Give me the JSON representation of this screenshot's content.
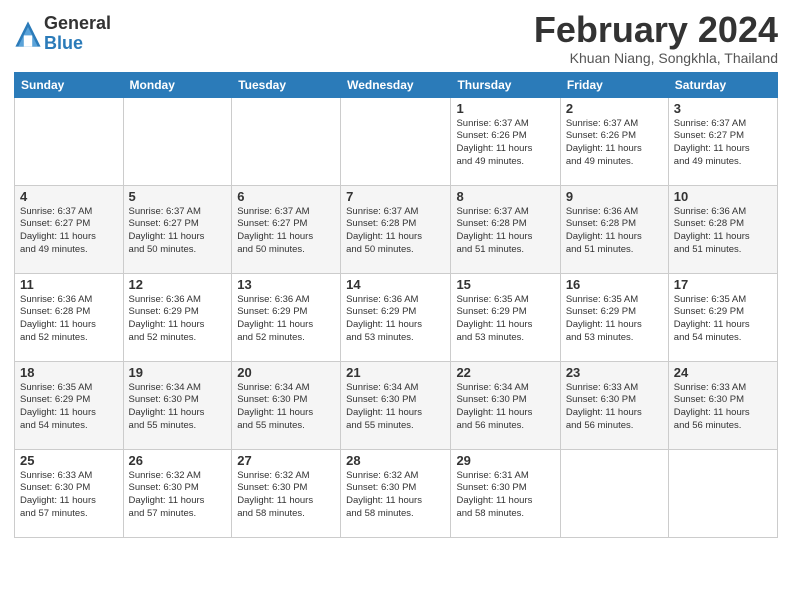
{
  "logo": {
    "general": "General",
    "blue": "Blue"
  },
  "title": {
    "month_year": "February 2024",
    "location": "Khuan Niang, Songkhla, Thailand"
  },
  "days_of_week": [
    "Sunday",
    "Monday",
    "Tuesday",
    "Wednesday",
    "Thursday",
    "Friday",
    "Saturday"
  ],
  "weeks": [
    [
      {
        "day": "",
        "info": ""
      },
      {
        "day": "",
        "info": ""
      },
      {
        "day": "",
        "info": ""
      },
      {
        "day": "",
        "info": ""
      },
      {
        "day": "1",
        "info": "Sunrise: 6:37 AM\nSunset: 6:26 PM\nDaylight: 11 hours\nand 49 minutes."
      },
      {
        "day": "2",
        "info": "Sunrise: 6:37 AM\nSunset: 6:26 PM\nDaylight: 11 hours\nand 49 minutes."
      },
      {
        "day": "3",
        "info": "Sunrise: 6:37 AM\nSunset: 6:27 PM\nDaylight: 11 hours\nand 49 minutes."
      }
    ],
    [
      {
        "day": "4",
        "info": "Sunrise: 6:37 AM\nSunset: 6:27 PM\nDaylight: 11 hours\nand 49 minutes."
      },
      {
        "day": "5",
        "info": "Sunrise: 6:37 AM\nSunset: 6:27 PM\nDaylight: 11 hours\nand 50 minutes."
      },
      {
        "day": "6",
        "info": "Sunrise: 6:37 AM\nSunset: 6:27 PM\nDaylight: 11 hours\nand 50 minutes."
      },
      {
        "day": "7",
        "info": "Sunrise: 6:37 AM\nSunset: 6:28 PM\nDaylight: 11 hours\nand 50 minutes."
      },
      {
        "day": "8",
        "info": "Sunrise: 6:37 AM\nSunset: 6:28 PM\nDaylight: 11 hours\nand 51 minutes."
      },
      {
        "day": "9",
        "info": "Sunrise: 6:36 AM\nSunset: 6:28 PM\nDaylight: 11 hours\nand 51 minutes."
      },
      {
        "day": "10",
        "info": "Sunrise: 6:36 AM\nSunset: 6:28 PM\nDaylight: 11 hours\nand 51 minutes."
      }
    ],
    [
      {
        "day": "11",
        "info": "Sunrise: 6:36 AM\nSunset: 6:28 PM\nDaylight: 11 hours\nand 52 minutes."
      },
      {
        "day": "12",
        "info": "Sunrise: 6:36 AM\nSunset: 6:29 PM\nDaylight: 11 hours\nand 52 minutes."
      },
      {
        "day": "13",
        "info": "Sunrise: 6:36 AM\nSunset: 6:29 PM\nDaylight: 11 hours\nand 52 minutes."
      },
      {
        "day": "14",
        "info": "Sunrise: 6:36 AM\nSunset: 6:29 PM\nDaylight: 11 hours\nand 53 minutes."
      },
      {
        "day": "15",
        "info": "Sunrise: 6:35 AM\nSunset: 6:29 PM\nDaylight: 11 hours\nand 53 minutes."
      },
      {
        "day": "16",
        "info": "Sunrise: 6:35 AM\nSunset: 6:29 PM\nDaylight: 11 hours\nand 53 minutes."
      },
      {
        "day": "17",
        "info": "Sunrise: 6:35 AM\nSunset: 6:29 PM\nDaylight: 11 hours\nand 54 minutes."
      }
    ],
    [
      {
        "day": "18",
        "info": "Sunrise: 6:35 AM\nSunset: 6:29 PM\nDaylight: 11 hours\nand 54 minutes."
      },
      {
        "day": "19",
        "info": "Sunrise: 6:34 AM\nSunset: 6:30 PM\nDaylight: 11 hours\nand 55 minutes."
      },
      {
        "day": "20",
        "info": "Sunrise: 6:34 AM\nSunset: 6:30 PM\nDaylight: 11 hours\nand 55 minutes."
      },
      {
        "day": "21",
        "info": "Sunrise: 6:34 AM\nSunset: 6:30 PM\nDaylight: 11 hours\nand 55 minutes."
      },
      {
        "day": "22",
        "info": "Sunrise: 6:34 AM\nSunset: 6:30 PM\nDaylight: 11 hours\nand 56 minutes."
      },
      {
        "day": "23",
        "info": "Sunrise: 6:33 AM\nSunset: 6:30 PM\nDaylight: 11 hours\nand 56 minutes."
      },
      {
        "day": "24",
        "info": "Sunrise: 6:33 AM\nSunset: 6:30 PM\nDaylight: 11 hours\nand 56 minutes."
      }
    ],
    [
      {
        "day": "25",
        "info": "Sunrise: 6:33 AM\nSunset: 6:30 PM\nDaylight: 11 hours\nand 57 minutes."
      },
      {
        "day": "26",
        "info": "Sunrise: 6:32 AM\nSunset: 6:30 PM\nDaylight: 11 hours\nand 57 minutes."
      },
      {
        "day": "27",
        "info": "Sunrise: 6:32 AM\nSunset: 6:30 PM\nDaylight: 11 hours\nand 58 minutes."
      },
      {
        "day": "28",
        "info": "Sunrise: 6:32 AM\nSunset: 6:30 PM\nDaylight: 11 hours\nand 58 minutes."
      },
      {
        "day": "29",
        "info": "Sunrise: 6:31 AM\nSunset: 6:30 PM\nDaylight: 11 hours\nand 58 minutes."
      },
      {
        "day": "",
        "info": ""
      },
      {
        "day": "",
        "info": ""
      }
    ]
  ]
}
